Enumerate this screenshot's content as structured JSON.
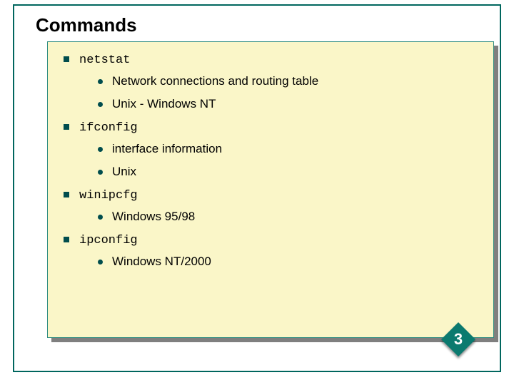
{
  "title": "Commands",
  "commands": [
    {
      "name": "netstat",
      "details": [
        "Network connections and routing table",
        "Unix - Windows NT"
      ]
    },
    {
      "name": "ifconfig",
      "details": [
        "interface information",
        "Unix"
      ]
    },
    {
      "name": "winipcfg",
      "details": [
        "Windows 95/98"
      ]
    },
    {
      "name": "ipconfig",
      "details": [
        "Windows NT/2000"
      ]
    }
  ],
  "page_number": "3"
}
